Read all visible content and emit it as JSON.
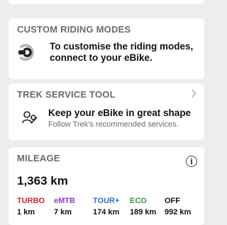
{
  "custom_modes": {
    "title": "CUSTOM RIDING MODES",
    "message": "To customise the riding modes, connect to your eBike."
  },
  "service_tool": {
    "title": "TREK SERVICE TOOL",
    "headline": "Keep your eBike in great shape",
    "subtext": "Follow Trek's recommended services."
  },
  "mileage": {
    "title": "MILEAGE",
    "total": "1,363 km",
    "modes": [
      {
        "name": "TURBO",
        "km": "1 km",
        "color": "#d4262b"
      },
      {
        "name": "eMTB",
        "km": "7 km",
        "color": "#8a3fd1"
      },
      {
        "name": "TOUR+",
        "km": "174 km",
        "color": "#2e6fd6"
      },
      {
        "name": "ECO",
        "km": "189 km",
        "color": "#2e9e3e"
      },
      {
        "name": "OFF",
        "km": "992 km",
        "color": "#111111"
      }
    ]
  }
}
